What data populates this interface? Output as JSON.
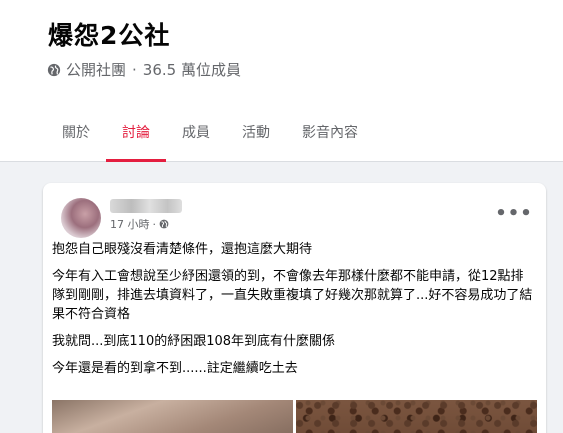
{
  "group": {
    "name": "爆怨2公社",
    "privacy": "公開社團",
    "member_count": "36.5 萬位成員"
  },
  "tabs": [
    {
      "label": "關於",
      "active": false
    },
    {
      "label": "討論",
      "active": true
    },
    {
      "label": "成員",
      "active": false
    },
    {
      "label": "活動",
      "active": false
    },
    {
      "label": "影音內容",
      "active": false
    }
  ],
  "post": {
    "time": "17 小時",
    "paragraphs": [
      "抱怨自己眼殘沒看清楚條件，還抱這麼大期待",
      "今年有入工會想說至少紓困還領的到，不會像去年那樣什麼都不能申請，從12點排隊到剛剛，排進去填資料了，一直失敗重複填了好幾次那就算了...好不容易成功了結果不符合資格",
      "我就問...到底110的紓困跟108年到底有什麼關係",
      "今年還是看的到拿不到......註定繼續吃土去"
    ]
  },
  "colors": {
    "accent": "#e41e3f",
    "secondary_text": "#65676b",
    "background": "#f0f2f5"
  },
  "icons": [
    "globe-icon",
    "more-options-icon"
  ]
}
